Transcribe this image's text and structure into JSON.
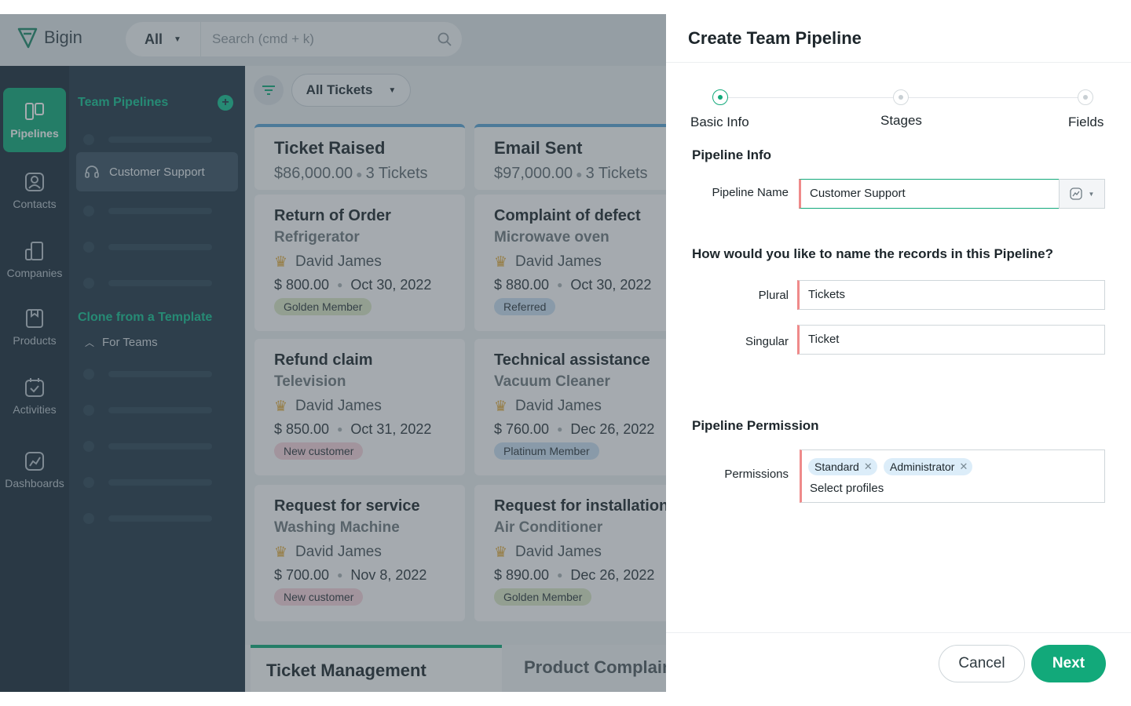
{
  "app": {
    "name": "Bigin",
    "search": {
      "scope": "All",
      "placeholder": "Search (cmd + k)"
    },
    "rail": [
      {
        "label": "Pipelines",
        "icon": "pipelines-icon",
        "active": true
      },
      {
        "label": "Contacts",
        "icon": "contacts-icon"
      },
      {
        "label": "Companies",
        "icon": "companies-icon"
      },
      {
        "label": "Products",
        "icon": "products-icon"
      },
      {
        "label": "Activities",
        "icon": "activities-icon"
      },
      {
        "label": "Dashboards",
        "icon": "dashboards-icon"
      }
    ],
    "panel": {
      "team_pipelines": "Team Pipelines",
      "selected": "Customer Support",
      "clone": "Clone from a Template",
      "for_teams": "For Teams"
    },
    "board": {
      "view": "All Tickets",
      "columns": [
        {
          "title": "Ticket Raised",
          "amount": "$86,000.00",
          "count": "3 Tickets"
        },
        {
          "title": "Email Sent",
          "amount": "$97,000.00",
          "count": "3 Tickets"
        }
      ],
      "cards": [
        {
          "title": "Return of Order",
          "product": "Refrigerator",
          "owner": "David James",
          "amount": "$ 800.00",
          "date": "Oct 30, 2022",
          "tag": "Golden Member",
          "tag_color": "#dbe8c6"
        },
        {
          "title": "Complaint of defect",
          "product": "Microwave oven",
          "owner": "David James",
          "amount": "$ 880.00",
          "date": "Oct 30, 2022",
          "tag": "Referred",
          "tag_color": "#c9dff3"
        },
        {
          "title": "Refund claim",
          "product": "Television",
          "owner": "David James",
          "amount": "$ 850.00",
          "date": "Oct 31, 2022",
          "tag": "New customer",
          "tag_color": "#f6d3dc"
        },
        {
          "title": "Technical assistance",
          "product": "Vacuum Cleaner",
          "owner": "David James",
          "amount": "$ 760.00",
          "date": "Dec 26, 2022",
          "tag": "Platinum Member",
          "tag_color": "#c9dff3"
        },
        {
          "title": "Request for service",
          "product": "Washing Machine",
          "owner": "David James",
          "amount": "$ 700.00",
          "date": "Nov 8, 2022",
          "tag": "New customer",
          "tag_color": "#f6d3dc"
        },
        {
          "title": "Request for installation",
          "product": "Air Conditioner",
          "owner": "David James",
          "amount": "$ 890.00",
          "date": "Dec 26, 2022",
          "tag": "Golden Member",
          "tag_color": "#dbe8c6"
        }
      ],
      "tabs": [
        "Ticket Management",
        "Product Complain"
      ]
    }
  },
  "drawer": {
    "title": "Create Team Pipeline",
    "steps": [
      "Basic Info",
      "Stages",
      "Fields"
    ],
    "active_step": "Basic Info",
    "pipeline_info": {
      "heading": "Pipeline Info",
      "name_label": "Pipeline Name",
      "name_value": "Customer Support"
    },
    "records": {
      "heading": "How would you like to name the records in this Pipeline?",
      "plural_label": "Plural",
      "plural_value": "Tickets",
      "singular_label": "Singular",
      "singular_value": "Ticket"
    },
    "permission": {
      "heading": "Pipeline Permission",
      "label": "Permissions",
      "chips": [
        "Standard",
        "Administrator"
      ],
      "placeholder": "Select profiles"
    },
    "buttons": {
      "cancel": "Cancel",
      "next": "Next"
    }
  },
  "colors": {
    "accent": "#12a97a",
    "required": "#ef8a8a",
    "rail": "#1c2f3d"
  }
}
